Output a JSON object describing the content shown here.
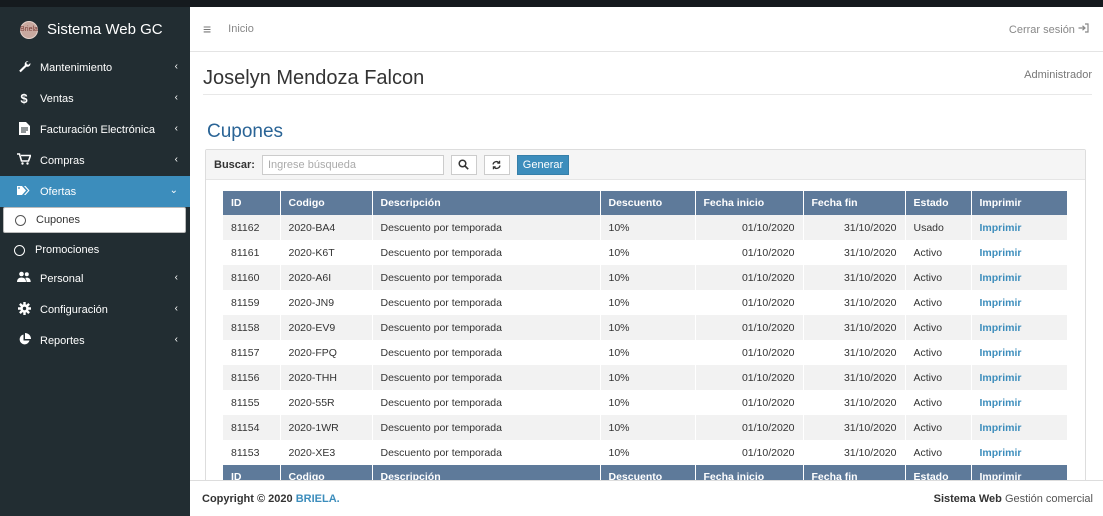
{
  "brand": {
    "name": "Sistema Web GC",
    "logo_text": "Briela"
  },
  "sidebar": {
    "items": [
      {
        "label": "Mantenimiento",
        "icon": "wrench-icon"
      },
      {
        "label": "Ventas",
        "icon": "dollar-icon"
      },
      {
        "label": "Facturación Electrónica",
        "icon": "document-icon"
      },
      {
        "label": "Compras",
        "icon": "cart-icon"
      },
      {
        "label": "Ofertas",
        "icon": "tags-icon"
      },
      {
        "label": "Cupones"
      },
      {
        "label": "Promociones"
      },
      {
        "label": "Personal",
        "icon": "users-icon"
      },
      {
        "label": "Configuración",
        "icon": "gear-icon"
      },
      {
        "label": "Reportes",
        "icon": "pie-chart-icon"
      }
    ]
  },
  "topbar": {
    "home": "Inicio",
    "logout": "Cerrar sesión"
  },
  "header": {
    "user": "Joselyn Mendoza Falcon",
    "role": "Administrador"
  },
  "section_title": "Cupones",
  "search": {
    "label": "Buscar:",
    "placeholder": "Ingrese búsqueda",
    "generate": "Generar"
  },
  "table": {
    "columns": [
      "ID",
      "Codigo",
      "Descripción",
      "Descuento",
      "Fecha inicio",
      "Fecha fin",
      "Estado",
      "Imprimir"
    ],
    "rows": [
      [
        "81162",
        "2020-BA4",
        "Descuento por temporada",
        "10%",
        "01/10/2020",
        "31/10/2020",
        "Usado",
        "Imprimir"
      ],
      [
        "81161",
        "2020-K6T",
        "Descuento por temporada",
        "10%",
        "01/10/2020",
        "31/10/2020",
        "Activo",
        "Imprimir"
      ],
      [
        "81160",
        "2020-A6I",
        "Descuento por temporada",
        "10%",
        "01/10/2020",
        "31/10/2020",
        "Activo",
        "Imprimir"
      ],
      [
        "81159",
        "2020-JN9",
        "Descuento por temporada",
        "10%",
        "01/10/2020",
        "31/10/2020",
        "Activo",
        "Imprimir"
      ],
      [
        "81158",
        "2020-EV9",
        "Descuento por temporada",
        "10%",
        "01/10/2020",
        "31/10/2020",
        "Activo",
        "Imprimir"
      ],
      [
        "81157",
        "2020-FPQ",
        "Descuento por temporada",
        "10%",
        "01/10/2020",
        "31/10/2020",
        "Activo",
        "Imprimir"
      ],
      [
        "81156",
        "2020-THH",
        "Descuento por temporada",
        "10%",
        "01/10/2020",
        "31/10/2020",
        "Activo",
        "Imprimir"
      ],
      [
        "81155",
        "2020-55R",
        "Descuento por temporada",
        "10%",
        "01/10/2020",
        "31/10/2020",
        "Activo",
        "Imprimir"
      ],
      [
        "81154",
        "2020-1WR",
        "Descuento por temporada",
        "10%",
        "01/10/2020",
        "31/10/2020",
        "Activo",
        "Imprimir"
      ],
      [
        "81153",
        "2020-XE3",
        "Descuento por temporada",
        "10%",
        "01/10/2020",
        "31/10/2020",
        "Activo",
        "Imprimir"
      ]
    ]
  },
  "footer": {
    "copyright": "Copyright © 2020",
    "company": "BRIELA.",
    "system_bold": "Sistema Web",
    "system_rest": "Gestión comercial"
  },
  "colors": {
    "sidebar": "#222d32",
    "accent": "#3c8dbc",
    "table_header": "#5e7a9a",
    "title": "#2a6496"
  }
}
